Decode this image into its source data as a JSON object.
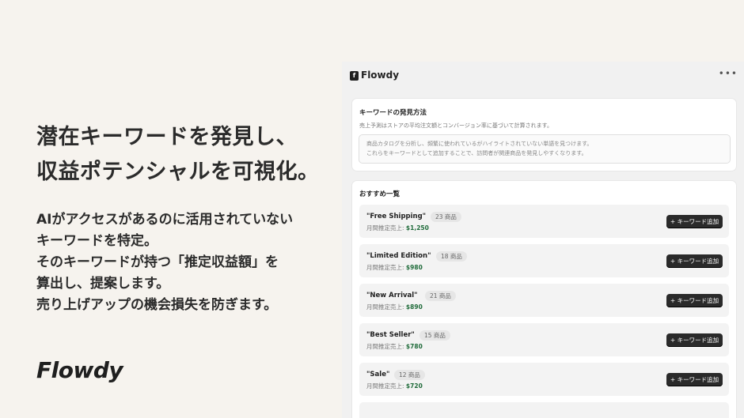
{
  "hero": {
    "headline": [
      "潜在キーワードを発見し、",
      "収益ポテンシャルを可視化。"
    ],
    "body": [
      "AIがアクセスがあるのに活用されていない",
      "キーワードを特定。",
      "そのキーワードが持つ「推定収益額」を",
      "算出し、提案します。",
      "売り上げアップの機会損失を防ぎます。"
    ],
    "brand": "Flowdy"
  },
  "app": {
    "title": "Flowdy",
    "logo_mark": "f",
    "menu_glyph": "•••",
    "method": {
      "title": "キーワードの発見方法",
      "subtitle": "売上予測はストアの平均注文額とコンバージョン率に基づいて計算されます。",
      "info_lines": [
        "商品カタログを分析し、頻繁に使われているがハイライトされていない単語を見つけます。",
        "これらをキーワードとして追加することで、訪問者が関連商品を発見しやすくなります。"
      ]
    },
    "recommendations": {
      "title": "おすすめ一覧",
      "sales_label": "月間推定売上: ",
      "button_label": "+ キーワード追加",
      "items": [
        {
          "name": "\"Free Shipping\"",
          "count": "23 商品",
          "sales": "$1,250"
        },
        {
          "name": "\"Limited Edition\"",
          "count": "18 商品",
          "sales": "$980"
        },
        {
          "name": "\"New Arrival\"",
          "count": "21 商品",
          "sales": "$890"
        },
        {
          "name": "\"Best Seller\"",
          "count": "15 商品",
          "sales": "$780"
        },
        {
          "name": "\"Sale\"",
          "count": "12 商品",
          "sales": "$720"
        }
      ]
    }
  }
}
